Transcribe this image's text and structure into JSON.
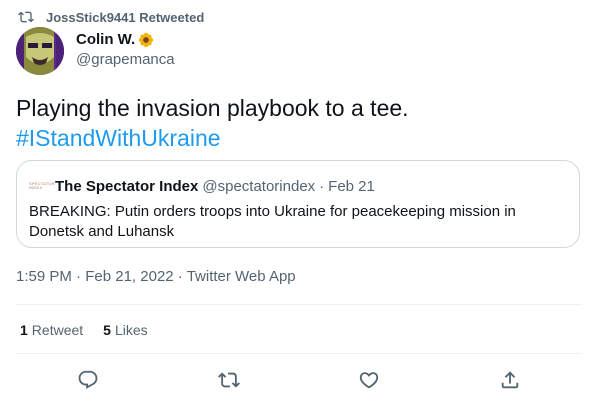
{
  "retweet_context": {
    "label": "JossStick9441 Retweeted",
    "icon": "retweet-icon"
  },
  "author": {
    "display_name": "Colin W.",
    "name_emoji": "sunflower-icon",
    "handle": "@grapemanca",
    "avatar": "avatar-icon"
  },
  "tweet": {
    "text": "Playing the invasion playbook to a tee.",
    "hashtag": "#IStandWithUkraine"
  },
  "quote": {
    "name": "The Spectator Index",
    "handle": "@spectatorindex",
    "separator": "·",
    "date": "Feb 21",
    "avatar_line1": "SPECTATOR",
    "avatar_line2": "INDEX",
    "body": "BREAKING: Putin orders troops into Ukraine for peacekeeping mission in Donetsk and Luhansk"
  },
  "meta": {
    "time": "1:59 PM",
    "date": "Feb 21, 2022",
    "source": "Twitter Web App",
    "separator": "·"
  },
  "stats": {
    "retweets_count": "1",
    "retweets_label": "Retweet",
    "likes_count": "5",
    "likes_label": "Likes"
  },
  "actions": [
    "reply-icon",
    "retweet-icon",
    "like-icon",
    "share-icon"
  ],
  "colors": {
    "text_primary": "#0f1419",
    "text_secondary": "#536471",
    "link": "#1d9bf0",
    "border": "#cfd9de",
    "divider": "#eff3f4"
  }
}
